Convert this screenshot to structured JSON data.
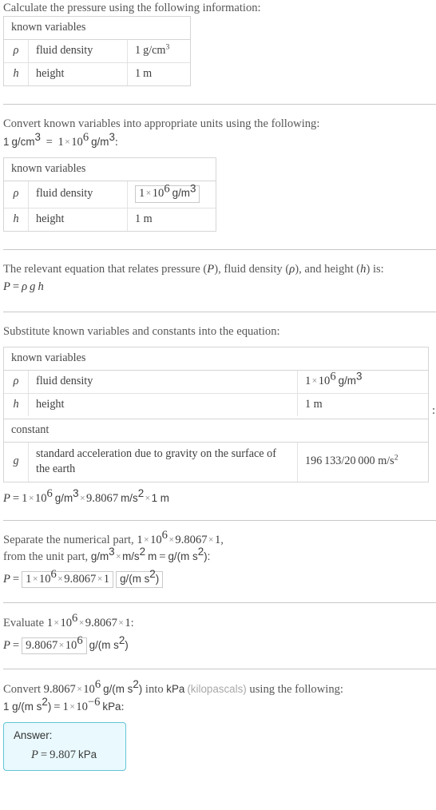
{
  "document": {
    "type": "step-by-step-solution",
    "accent_color": "#63c5d8",
    "answer_bg_color": "#e9f9fd",
    "text_color": "#575757"
  },
  "steps": [
    {
      "id": "step1",
      "prompt": "Calculate the pressure using the following information:",
      "table": {
        "header": "known variables",
        "rows": [
          {
            "symbol": "ρ",
            "name": "fluid density",
            "value_num": "1",
            "value_unit": "g/cm",
            "value_sup": "3"
          },
          {
            "symbol": "h",
            "name": "height",
            "value_num": "1",
            "value_unit": "m",
            "value_sup": ""
          }
        ]
      }
    },
    {
      "id": "step2",
      "prompt": "Convert known variables into appropriate units using the following:",
      "conversion": {
        "lhs_num": "1",
        "lhs_unit": "g/cm",
        "lhs_sup": "3",
        "eq": "=",
        "rhs_mantissa": "1",
        "rhs_times": "×",
        "rhs_base": "10",
        "rhs_exp": "6",
        "rhs_unit": "g/m",
        "rhs_unit_sup": "3",
        "trailing": ":"
      },
      "table": {
        "header": "known variables",
        "rows": [
          {
            "symbol": "ρ",
            "name": "fluid density",
            "boxed": true,
            "value_mantissa": "1",
            "value_base": "10",
            "value_exp": "6",
            "value_unit": "g/m",
            "value_unit_sup": "3"
          },
          {
            "symbol": "h",
            "name": "height",
            "boxed": false,
            "value_plain": "1 m"
          }
        ]
      }
    },
    {
      "id": "step3",
      "prompt_parts": {
        "a": "The relevant equation that relates pressure (",
        "var_p": "P",
        "b": "), fluid density (",
        "var_rho": "ρ",
        "c": "), and height (",
        "var_h": "h",
        "d": ") is:"
      },
      "equation": {
        "lhs": "P",
        "eq": "=",
        "rho": "ρ",
        "g": "g",
        "h": "h"
      }
    },
    {
      "id": "step4",
      "prompt": "Substitute known variables and constants into the equation:",
      "table_colon": ":",
      "table": {
        "header_variables": "known variables",
        "header_constant": "constant",
        "rows": [
          {
            "symbol": "ρ",
            "name": "fluid density",
            "value_mantissa": "1",
            "value_base": "10",
            "value_exp": "6",
            "value_unit": "g/m",
            "value_unit_sup": "3"
          },
          {
            "symbol": "h",
            "name": "height",
            "value_plain": "1 m"
          }
        ],
        "constant_row": {
          "symbol": "g",
          "name": "standard acceleration due to gravity on the surface of the earth",
          "value_plain": "196 133/20 000 m/s",
          "value_sup": "2"
        }
      },
      "result": {
        "lhs": "P",
        "eq": "=",
        "t1_mantissa": "1",
        "t1_base": "10",
        "t1_exp": "6",
        "t1_unit": "g/m",
        "t1_unit_sup": "3",
        "op1": "×",
        "t2_value": "9.8067",
        "t2_unit": "m/s",
        "t2_unit_sup": "2",
        "op2": "×",
        "t3": "1 m"
      }
    },
    {
      "id": "step5",
      "prompt_line1": {
        "a": "Separate the numerical part, ",
        "mantissa": "1",
        "base": "10",
        "exp": "6",
        "op1": "×",
        "val": "9.8067",
        "op2": "×",
        "one": "1",
        "comma": ","
      },
      "prompt_line2": {
        "a": "from the unit part, ",
        "u1": "g/m",
        "u1_sup": "3",
        "op": "×",
        "u2": "m/s",
        "u2_sup": "2",
        "u3": "m",
        "eq": "=",
        "u4": "g/(m s",
        "u4_sup": "2",
        "u5": "):"
      },
      "result": {
        "lhs": "P",
        "eq": "=",
        "boxed_num": {
          "mantissa": "1",
          "base": "10",
          "exp": "6",
          "op1": "×",
          "val": "9.8067",
          "op2": "×",
          "one": "1"
        },
        "boxed_unit": {
          "text": "g/(m s",
          "sup": "2",
          "tail": ")"
        }
      }
    },
    {
      "id": "step6",
      "prompt": {
        "a": "Evaluate ",
        "mantissa": "1",
        "base": "10",
        "exp": "6",
        "op1": "×",
        "val": "9.8067",
        "op2": "×",
        "one": "1",
        "colon": ":"
      },
      "result": {
        "lhs": "P",
        "eq": "=",
        "boxed_mantissa": "9.8067",
        "boxed_times": "×",
        "boxed_base": "10",
        "boxed_exp": "6",
        "unit": "g/(m s",
        "unit_sup": "2",
        "unit_tail": ")"
      }
    },
    {
      "id": "step7",
      "prompt_line1": {
        "a": "Convert ",
        "mantissa": "9.8067",
        "base": "10",
        "exp": "6",
        "unit": "g/(m s",
        "unit_sup": "2",
        "unit_tail": ")",
        "b": " into ",
        "target_unit": "kPa",
        "paren": "(kilopascals)",
        "c": " using the following:"
      },
      "prompt_line2": {
        "lhs": "1 g/(m s",
        "lhs_sup": "2",
        "lhs_tail": ")",
        "eq": "=",
        "mantissa": "1",
        "base": "10",
        "exp": "−6",
        "unit": "kPa",
        "colon": ":"
      },
      "answer": {
        "label": "Answer:",
        "lhs": "P",
        "eq": "=",
        "value": "9.807",
        "unit": "kPa"
      }
    }
  ]
}
